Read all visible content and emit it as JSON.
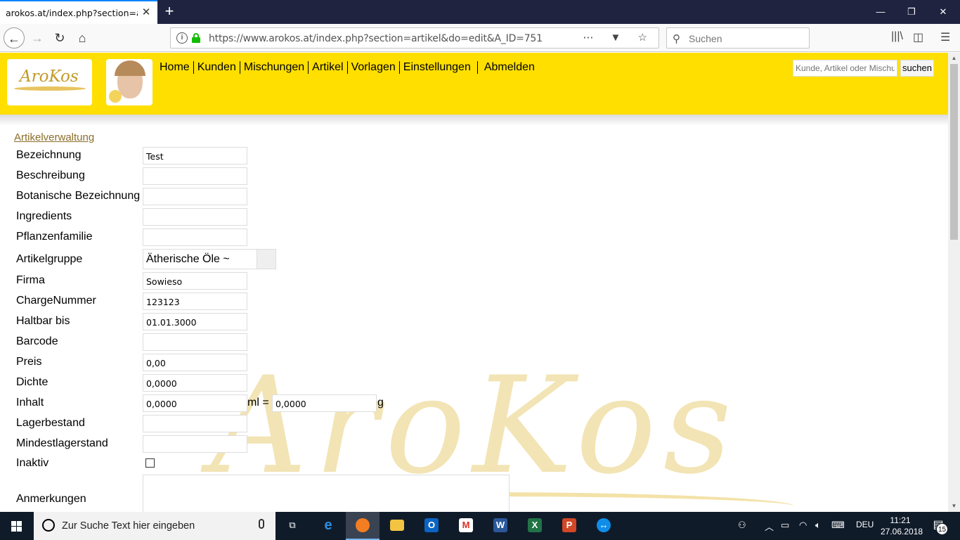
{
  "browser": {
    "tab_title": "arokos.at/index.php?section=artikel",
    "url": "https://www.arokos.at/index.php?section=artikel&do=edit&A_ID=751",
    "url_host_bold": "arokos.at",
    "search_placeholder": "Suchen"
  },
  "header": {
    "logo_text": "AroKos",
    "nav": [
      "Home",
      "Kunden",
      "Mischungen",
      "Artikel",
      "Vorlagen",
      "Einstellungen"
    ],
    "logout": "Abmelden",
    "search_placeholder": "Kunde, Artikel oder Mischung",
    "search_button": "suchen"
  },
  "breadcrumb": "Artikelverwaltung",
  "form": {
    "bezeichnung": {
      "label": "Bezeichnung",
      "value": "Test"
    },
    "beschreibung": {
      "label": "Beschreibung",
      "value": ""
    },
    "botanisch": {
      "label": "Botanische Bezeichnung",
      "value": ""
    },
    "ingredients": {
      "label": "Ingredients",
      "value": ""
    },
    "pflanzenfamilie": {
      "label": "Pflanzenfamilie",
      "value": ""
    },
    "artikelgruppe": {
      "label": "Artikelgruppe",
      "value": "Ätherische Öle ~"
    },
    "firma": {
      "label": "Firma",
      "value": "Sowieso"
    },
    "charge": {
      "label": "ChargeNummer",
      "value": "123123"
    },
    "haltbar": {
      "label": "Haltbar bis",
      "value": "01.01.3000"
    },
    "barcode": {
      "label": "Barcode",
      "value": ""
    },
    "preis": {
      "label": "Preis",
      "value": "0,00"
    },
    "dichte": {
      "label": "Dichte",
      "value": "0,0000"
    },
    "inhalt": {
      "label": "Inhalt",
      "value_ml": "0,0000",
      "unit_ml": "ml =",
      "value_g": "0,0000",
      "unit_g": "g"
    },
    "lagerbestand": {
      "label": "Lagerbestand",
      "value": ""
    },
    "mindestlager": {
      "label": "Mindestlagerstand",
      "value": ""
    },
    "inaktiv": {
      "label": "Inaktiv",
      "checked": false
    },
    "anmerkungen": {
      "label": "Anmerkungen",
      "value": ""
    }
  },
  "watermark_text": "AroKos",
  "taskbar": {
    "search_text": "Zur Suche Text hier eingeben",
    "apps": [
      "task-view",
      "edge",
      "firefox",
      "explorer",
      "outlook",
      "gmail",
      "word",
      "excel",
      "powerpoint",
      "teamviewer"
    ],
    "language": "DEU",
    "time": "11:21",
    "date": "27.06.2018",
    "notification_count": "15"
  },
  "colors": {
    "header_yellow": "#ffdf00",
    "taskbar": "#101b2a",
    "tabbar": "#202340",
    "breadcrumb": "#8b6e2a"
  }
}
